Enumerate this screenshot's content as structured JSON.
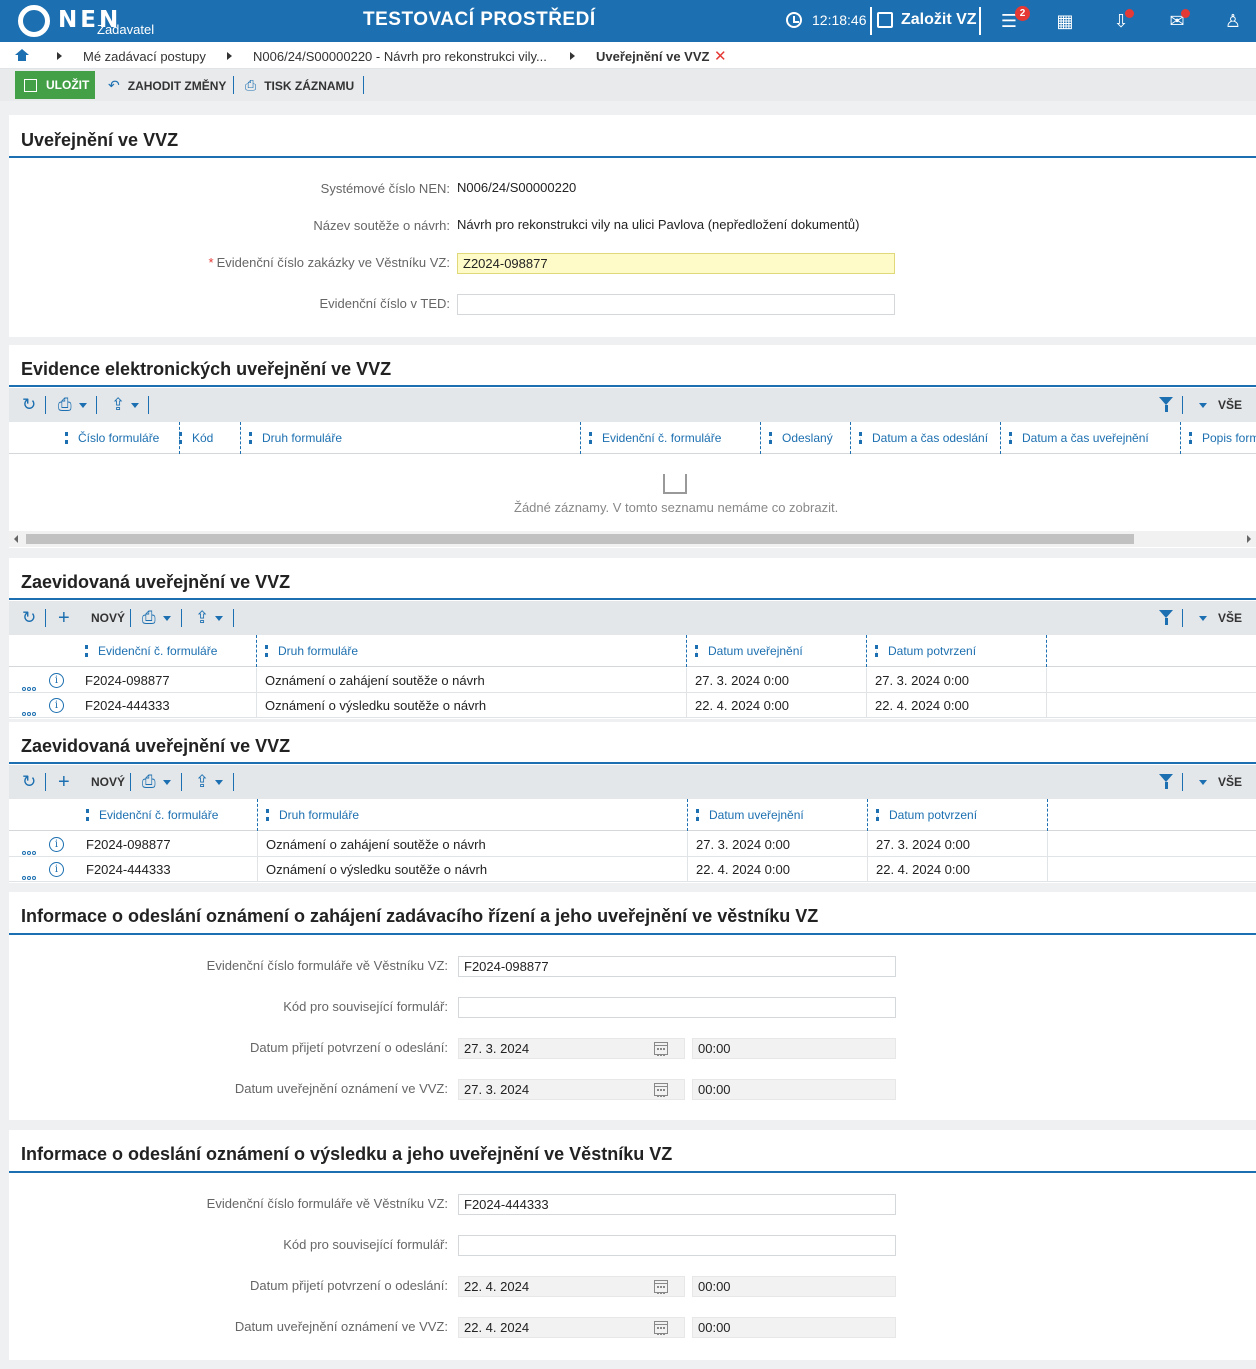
{
  "topbar": {
    "logo_text": "NEN",
    "logo_sub": "Zadavatel",
    "env_title": "TESTOVACÍ PROSTŘEDÍ",
    "clock": "12:18:46",
    "create_label": "Založit VZ",
    "menu_badge": "2",
    "accent_color": "#1c6fb0"
  },
  "breadcrumb": {
    "items": [
      "Mé zadávací postupy",
      "N006/24/S00000220 - Návrh pro rekonstrukci vily...",
      "Uveřejnění ve VVZ"
    ],
    "close": "✕"
  },
  "actions": {
    "save": "ULOŽIT",
    "discard": "ZAHODIT ZMĚNY",
    "print": "TISK ZÁZNAMU"
  },
  "section_main": {
    "title": "Uveřejnění ve VVZ",
    "fields": [
      {
        "label": "Systémové číslo NEN:",
        "value": "N006/24/S00000220"
      },
      {
        "label": "Název soutěže o návrh:",
        "value": "Návrh pro rekonstrukci vily na ulici Pavlova (nepředložení dokumentů)"
      },
      {
        "label": "Evidenční číslo zakázky ve Věstníku VZ:",
        "value": "Z2024-098877",
        "required": "*"
      },
      {
        "label": "Evidenční číslo v TED:",
        "value": ""
      }
    ]
  },
  "section_electronic": {
    "title": "Evidence elektronických uveřejnění ve VVZ",
    "filter_all": "VŠE",
    "columns": [
      "Číslo formuláře",
      "Kód",
      "Druh formuláře",
      "Evidenční č. formuláře",
      "Odeslaný",
      "Datum a čas odeslání",
      "Datum a čas uveřejnění",
      "Popis formuláře"
    ],
    "empty": "Žádné záznamy. V tomto seznamu nemáme co zobrazit."
  },
  "section_registered_1": {
    "title": "Zaevidovaná uveřejnění ve VVZ",
    "new_label": "NOVÝ",
    "filter_all": "VŠE",
    "columns": [
      "Evidenční č. formuláře",
      "Druh formuláře",
      "Datum uveřejnění",
      "Datum potvrzení"
    ],
    "rows": [
      {
        "code": "F2024-098877",
        "type": "Oznámení o zahájení soutěže o návrh",
        "published": "27. 3. 2024 0:00",
        "confirmed": "27. 3. 2024 0:00"
      },
      {
        "code": "F2024-444333",
        "type": "Oznámení o výsledku soutěže o návrh",
        "published": "22. 4. 2024 0:00",
        "confirmed": "22. 4. 2024 0:00"
      }
    ]
  },
  "section_registered_2": {
    "title": "Zaevidovaná uveřejnění ve VVZ",
    "new_label": "NOVÝ",
    "filter_all": "VŠE",
    "columns": [
      "Evidenční č. formuláře",
      "Druh formuláře",
      "Datum uveřejnění",
      "Datum potvrzení"
    ],
    "rows": [
      {
        "code": "F2024-098877",
        "type": "Oznámení o zahájení soutěže o návrh",
        "published": "27. 3. 2024 0:00",
        "confirmed": "27. 3. 2024 0:00"
      },
      {
        "code": "F2024-444333",
        "type": "Oznámení o výsledku soutěže o návrh",
        "published": "22. 4. 2024 0:00",
        "confirmed": "22. 4. 2024 0:00"
      }
    ]
  },
  "section_start": {
    "title": "Informace o odeslání oznámení o zahájení zadávacího řízení a jeho uveřejnění ve věstníku VZ",
    "fields": {
      "form_number_label": "Evidenční číslo formuláře vě Věstníku VZ:",
      "form_number": "F2024-098877",
      "related_code_label": "Kód pro související formulář:",
      "related_code": "",
      "confirm_label": "Datum přijetí potvrzení o odeslání:",
      "confirm_date": "27. 3. 2024",
      "confirm_time": "00:00",
      "publish_label": "Datum uveřejnění oznámení ve VVZ:",
      "publish_date": "27. 3. 2024",
      "publish_time": "00:00"
    }
  },
  "section_result": {
    "title": "Informace o odeslání oznámení o výsledku a jeho uveřejnění ve Věstníku VZ",
    "fields": {
      "form_number_label": "Evidenční číslo formuláře vě Věstníku VZ:",
      "form_number": "F2024-444333",
      "related_code_label": "Kód pro související formulář:",
      "related_code": "",
      "confirm_label": "Datum přijetí potvrzení o odeslání:",
      "confirm_date": "22. 4. 2024",
      "confirm_time": "00:00",
      "publish_label": "Datum uveřejnění oznámení ve VVZ:",
      "publish_date": "22. 4. 2024",
      "publish_time": "00:00"
    }
  }
}
